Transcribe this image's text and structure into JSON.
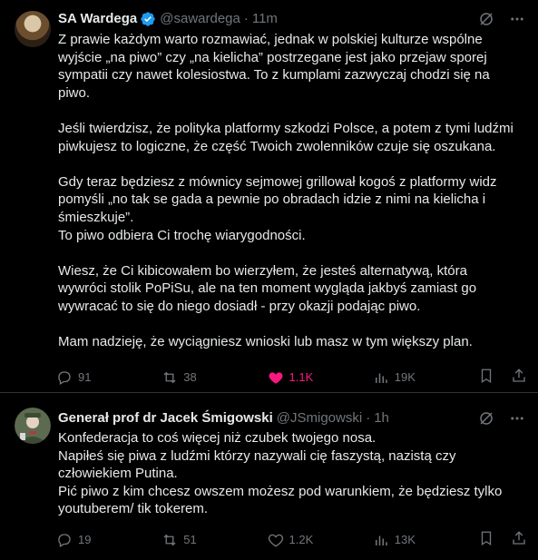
{
  "tweets": [
    {
      "author_name": "SA Wardega",
      "handle": "@sawardega",
      "separator": "·",
      "time": "11m",
      "verified": true,
      "lines": [
        "Z prawie każdym warto rozmawiać, jednak w polskiej kulturze wspólne",
        "wyjście „na piwo” czy „na kielicha” postrzegane jest jako przejaw sporej",
        "sympatii czy nawet kolesiostwa. To z kumplami zazwyczaj chodzi się na",
        "piwo.",
        "",
        "Jeśli twierdzisz, że polityka platformy szkodzi Polsce, a potem z tymi ludźmi",
        "piwkujesz to logiczne, że część Twoich zwolenników czuje się oszukana.",
        "",
        "Gdy teraz będziesz z mównicy sejmowej grillował kogoś z platformy widz",
        "pomyśli „no tak se gada a pewnie po obradach idzie z nimi na kielicha i",
        "śmieszkuje”.",
        "To piwo odbiera Ci trochę wiarygodności.",
        "",
        "Wiesz, że Ci kibicowałem bo wierzyłem, że jesteś alternatywą, która",
        "wywróci stolik PoPiSu, ale na ten moment wygląda jakbyś zamiast go",
        "wywracać to się do niego dosiadł - przy okazji podając piwo.",
        "",
        "Mam nadzieję, że wyciągniesz wnioski lub masz w tym większy plan."
      ],
      "replies": "91",
      "retweets": "38",
      "likes": "1.1K",
      "views": "19K",
      "liked": true
    },
    {
      "author_name": "Generał prof dr Jacek Śmigowski",
      "handle": "@JSmigowski",
      "separator": "·",
      "time": "1h",
      "verified": false,
      "lines": [
        "Konfederacja to coś więcej niż czubek twojego nosa.",
        "Napiłeś się piwa z ludźmi którzy nazywali cię faszystą, nazistą czy",
        "człowiekiem Putina.",
        "Pić piwo z kim chcesz owszem możesz pod warunkiem, że będziesz tylko",
        "youtuberem/ tik tokerem."
      ],
      "replies": "19",
      "retweets": "51",
      "likes": "1.2K",
      "views": "13K",
      "liked": false
    }
  ],
  "colors": {
    "background": "#000000",
    "text": "#e7e9ea",
    "muted": "#71767b",
    "like_active": "#f91880",
    "verified": "#1d9bf0",
    "divider": "#2f3336"
  }
}
